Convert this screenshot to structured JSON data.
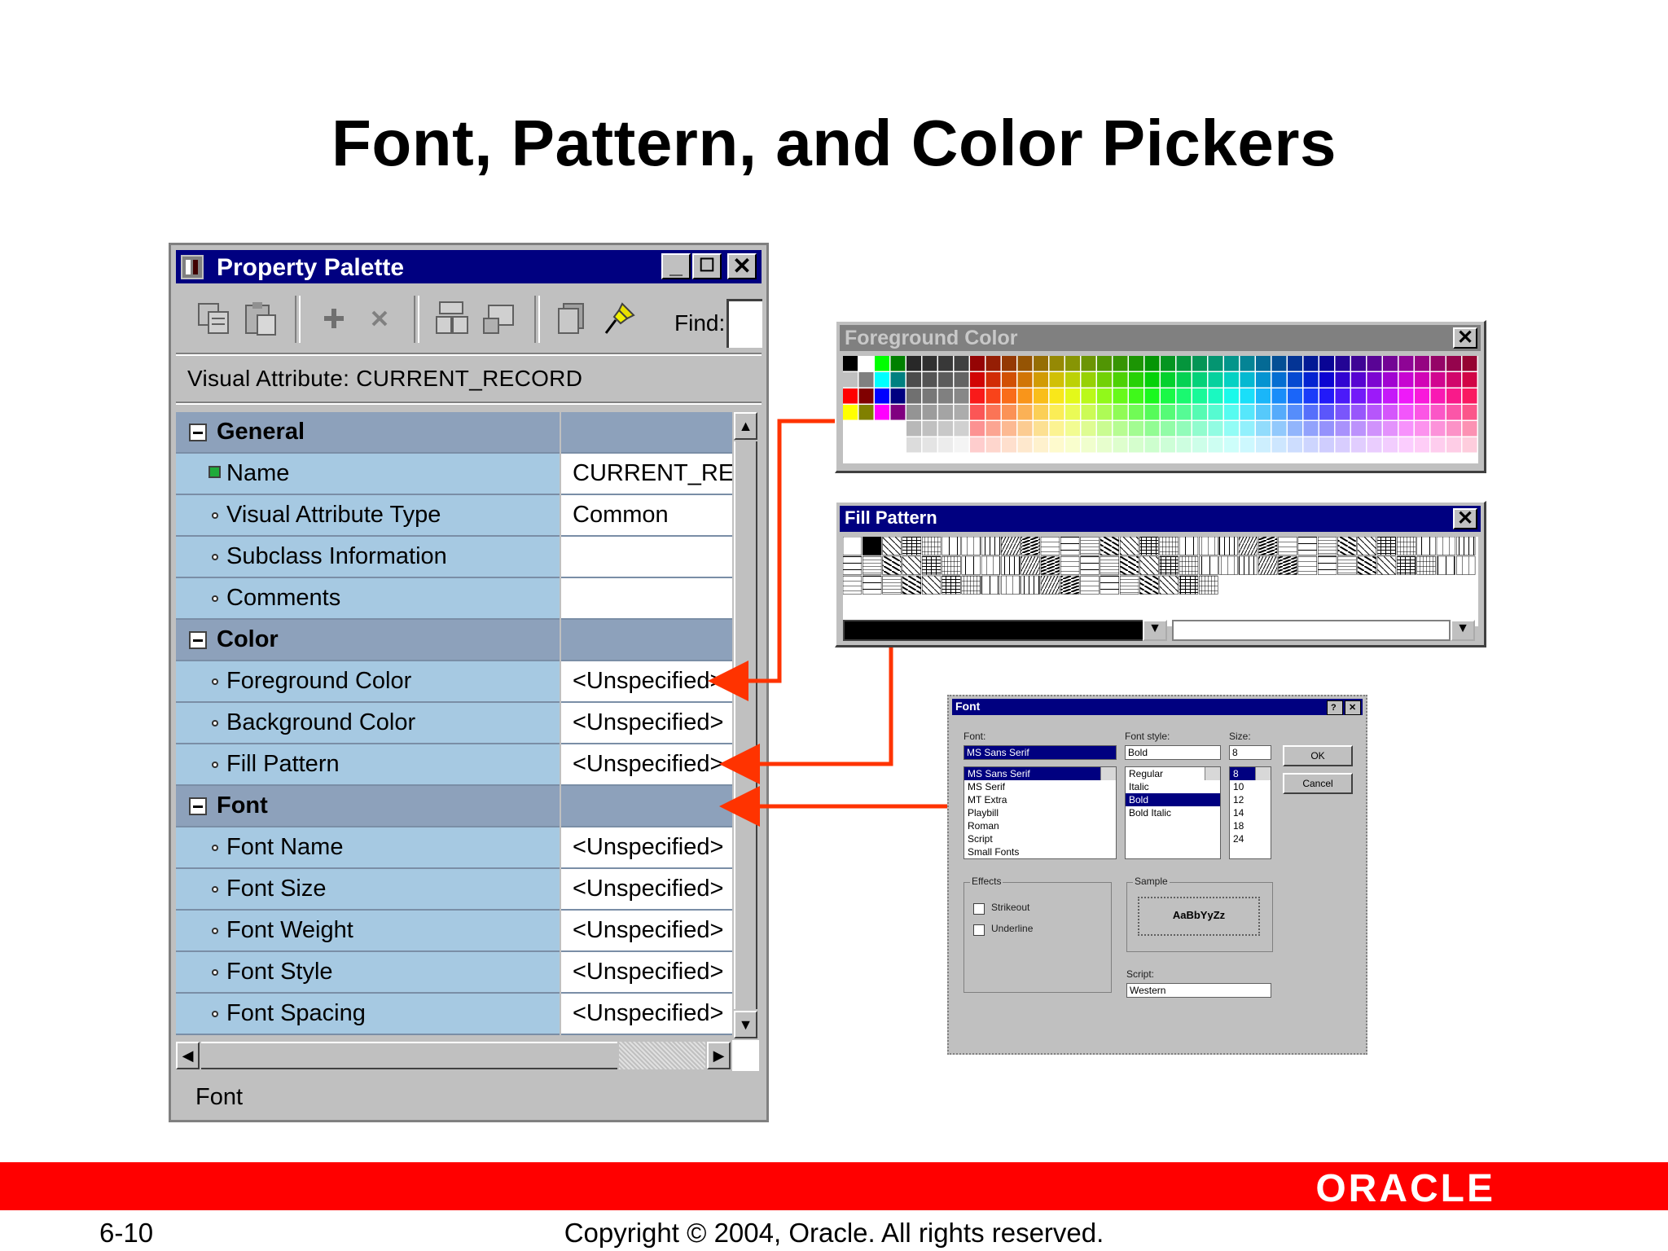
{
  "slide": {
    "title": "Font, Pattern, and Color Pickers",
    "page_number": "6-10",
    "copyright": "Copyright © 2004, Oracle.  All rights reserved.",
    "logo_text": "ORACLE"
  },
  "property_palette": {
    "title": "Property Palette",
    "find_label": "Find:",
    "visual_attribute_label": "Visual Attribute: CURRENT_RECORD",
    "status": "Font",
    "toolbar_icons": [
      "copy-properties-icon",
      "paste-properties-icon",
      "add-property-icon",
      "delete-property-icon",
      "union-icon",
      "intersection-icon",
      "freeze-icon",
      "pin-icon"
    ],
    "rows": [
      {
        "type": "category",
        "label": "General",
        "value": ""
      },
      {
        "type": "item",
        "label": "Name",
        "value": "CURRENT_RE",
        "marker": "green"
      },
      {
        "type": "item",
        "label": "Visual Attribute Type",
        "value": "Common"
      },
      {
        "type": "item",
        "label": "Subclass Information",
        "value": ""
      },
      {
        "type": "item",
        "label": "Comments",
        "value": ""
      },
      {
        "type": "category",
        "label": "Color",
        "value": ""
      },
      {
        "type": "item",
        "label": "Foreground Color",
        "value": "<Unspecified>"
      },
      {
        "type": "item",
        "label": "Background Color",
        "value": "<Unspecified>"
      },
      {
        "type": "item",
        "label": "Fill Pattern",
        "value": "<Unspecified>"
      },
      {
        "type": "category",
        "label": "Font",
        "value": ""
      },
      {
        "type": "item",
        "label": "Font Name",
        "value": "<Unspecified>"
      },
      {
        "type": "item",
        "label": "Font Size",
        "value": "<Unspecified>"
      },
      {
        "type": "item",
        "label": "Font Weight",
        "value": "<Unspecified>"
      },
      {
        "type": "item",
        "label": "Font Style",
        "value": "<Unspecified>"
      },
      {
        "type": "item",
        "label": "Font Spacing",
        "value": "<Unspecified>"
      }
    ]
  },
  "foreground_color": {
    "title": "Foreground Color"
  },
  "fill_pattern": {
    "title": "Fill Pattern"
  },
  "font_dialog": {
    "title": "Font",
    "font_label": "Font:",
    "font_value": "MS Sans Serif",
    "fonts": [
      "MS Sans Serif",
      "MS Serif",
      "MT Extra",
      "Playbill",
      "Roman",
      "Script",
      "Small Fonts"
    ],
    "style_label": "Font style:",
    "style_value": "Bold",
    "styles": [
      "Regular",
      "Italic",
      "Bold",
      "Bold Italic"
    ],
    "size_label": "Size:",
    "size_value": "8",
    "sizes": [
      "8",
      "10",
      "12",
      "14",
      "18",
      "24"
    ],
    "ok": "OK",
    "cancel": "Cancel",
    "effects_label": "Effects",
    "strikeout": "Strikeout",
    "underline": "Underline",
    "sample_label": "Sample",
    "sample_text": "AaBbYyZz",
    "script_label": "Script:",
    "script_value": "Western"
  },
  "colors": {
    "title_bar": "#000080",
    "name_cell": "#a6c9e2",
    "category_cell": "#8da1bb",
    "arrow": "#ff3300",
    "footer_bar": "#ff0000"
  }
}
